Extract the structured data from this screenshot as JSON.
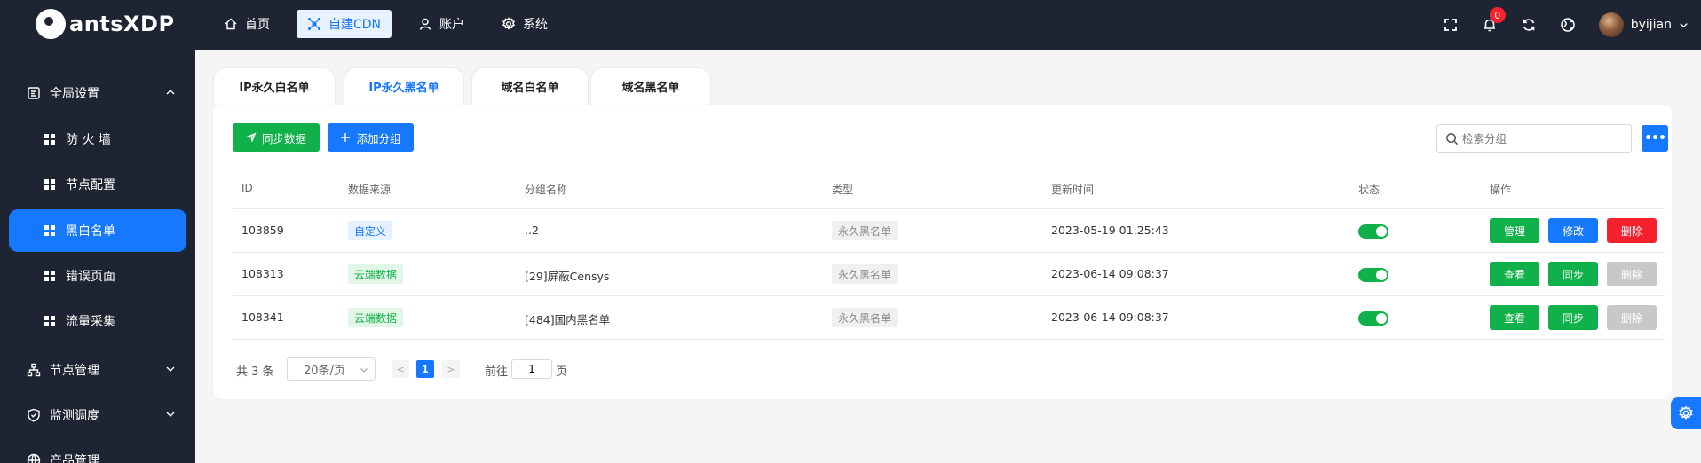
{
  "brand": {
    "name": "antsXDP"
  },
  "topnav": [
    {
      "label": "首页",
      "icon": "home-icon"
    },
    {
      "label": "自建CDN",
      "icon": "cdn-icon",
      "active": true
    },
    {
      "label": "账户",
      "icon": "user-icon"
    },
    {
      "label": "系统",
      "icon": "gear-icon"
    }
  ],
  "topbar": {
    "notifications_count": "0",
    "username": "byijian"
  },
  "sidebar": {
    "global_settings": "全局设置",
    "subitems": [
      "防 火 墙",
      "节点配置",
      "黑白名单",
      "错误页面",
      "流量采集"
    ],
    "active_index": 2,
    "node_management": "节点管理",
    "monitor_dispatch": "监测调度",
    "product_management": "产品管理"
  },
  "tabs": [
    "IP永久白名单",
    "IP永久黑名单",
    "域名白名单",
    "域名黑名单"
  ],
  "active_tab": 1,
  "toolbar": {
    "sync_label": "同步数据",
    "add_group_label": "添加分组",
    "search_placeholder": "检索分组",
    "more_label": "•••"
  },
  "table": {
    "columns": [
      "ID",
      "数据来源",
      "分组名称",
      "类型",
      "更新时间",
      "状态",
      "操作"
    ],
    "rows": [
      {
        "id": "103859",
        "source": "自定义",
        "name": "..2",
        "type": "永久黑名单",
        "updated": "2023-05-19 01:25:43",
        "enabled": true,
        "actions": [
          "管理",
          "修改",
          "删除"
        ]
      },
      {
        "id": "108313",
        "source": "云端数据",
        "name": "[29]屏蔽Censys",
        "type": "永久黑名单",
        "updated": "2023-06-14 09:08:37",
        "enabled": true,
        "actions": [
          "查看",
          "同步",
          "删除"
        ]
      },
      {
        "id": "108341",
        "source": "云端数据",
        "name": "[484]国内黑名单",
        "type": "永久黑名单",
        "updated": "2023-06-14 09:08:37",
        "enabled": true,
        "actions": [
          "查看",
          "同步",
          "删除"
        ]
      }
    ]
  },
  "pagination": {
    "total": "共 3 条",
    "page_size": "20条/页",
    "prev": "<",
    "current_page": "1",
    "next": ">",
    "goto_label": "前往",
    "goto_value": "1",
    "page_suffix": "页"
  },
  "colors": {
    "topbar_bg": "#1f2433",
    "primary": "#1677ff",
    "success": "#10b14a",
    "danger": "#f5222d",
    "disabled": "#c8c8c8"
  }
}
